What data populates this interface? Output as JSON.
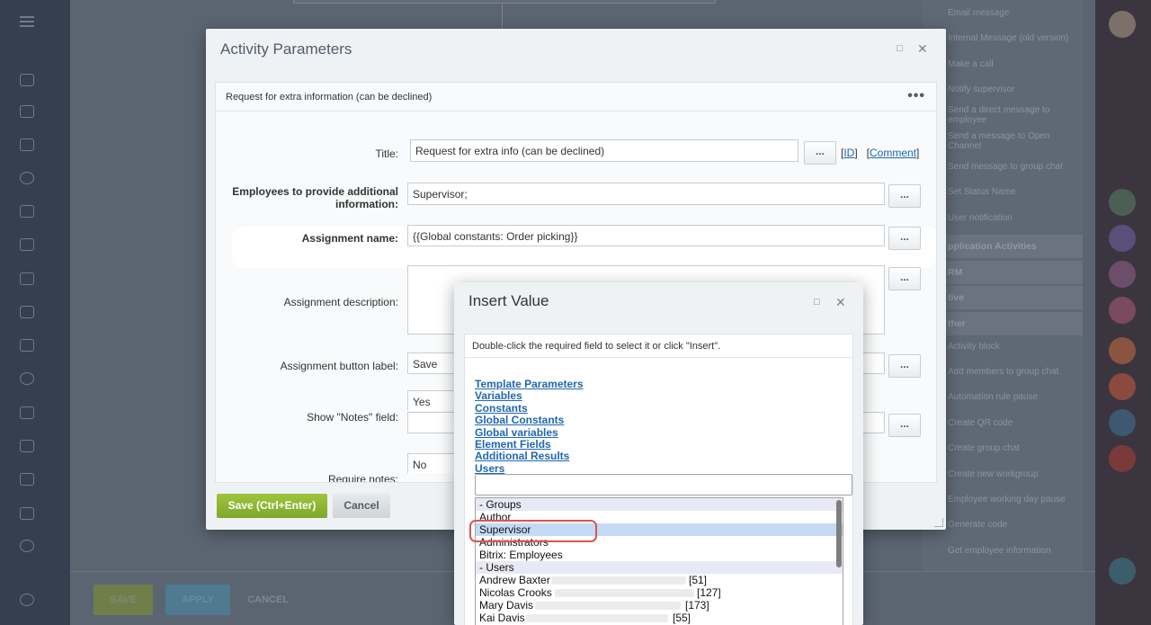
{
  "activity_dialog": {
    "title": "Activity Parameters",
    "subtitle": "Request for extra information (can be declined)",
    "fields": {
      "title_label": "Title:",
      "title_value": "Request for extra info (can be declined)",
      "employees_label_1": "Employees to provide additional",
      "employees_label_2": "information:",
      "employees_value": "Supervisor;",
      "assignment_name_label": "Assignment name:",
      "assignment_name_value": "{{Global constants: Order picking}}",
      "assignment_desc_label": "Assignment description:",
      "button_label_label": "Assignment button label:",
      "button_label_value": "Save",
      "notes_label": "Show \"Notes\" field:",
      "notes_value": "Yes",
      "require_notes_label": "Require notes:",
      "require_notes_value": "No"
    },
    "ellipsis": "...",
    "id_link": "ID",
    "comment_link": "Comment",
    "save_button": "Save (Ctrl+Enter)",
    "cancel_button": "Cancel"
  },
  "insert_value_dialog": {
    "title": "Insert Value",
    "hint": "Double-click the required field to select it or click \"Insert\".",
    "sections": [
      "Template Parameters",
      "Variables",
      "Constants",
      "Global Constants",
      "Global variables",
      "Element Fields",
      "Additional Results",
      "Users"
    ],
    "list": [
      {
        "label": "- Groups",
        "kind": "group"
      },
      {
        "label": "Author",
        "kind": "item"
      },
      {
        "label": "Supervisor",
        "kind": "selected"
      },
      {
        "label": "Administrators",
        "kind": "item"
      },
      {
        "label": "Bitrix: Employees",
        "kind": "item"
      },
      {
        "label": "- Users",
        "kind": "group"
      },
      {
        "label": "Andrew Baxter",
        "kind": "user",
        "id": "[51]"
      },
      {
        "label": "Nicolas Crooks",
        "kind": "user",
        "id": "[127]"
      },
      {
        "label": "Mary Davis",
        "kind": "user",
        "id": "[173]"
      },
      {
        "label": "Kai Davis",
        "kind": "user",
        "id": "[55]"
      }
    ]
  },
  "catalog": {
    "items": [
      "Email message",
      "Internal Message (old version)",
      "Make a call",
      "Notify supervisor",
      "Send a direct message to employee",
      "Send a message to Open Channel",
      "Send message to group chat",
      "Set Status Name",
      "User notification"
    ],
    "headers": [
      "pplication Activities",
      "RM",
      "tive",
      "ther"
    ],
    "other_items": [
      "Activity block",
      "Add members to group chat",
      "Automation rule pause",
      "Create QR code",
      "Create group chat",
      "Create new workgroup",
      "Employee working day pause",
      "Generate code",
      "Get employee information"
    ]
  },
  "bottom_bar": {
    "save": "SAVE",
    "apply": "APPLY",
    "cancel": "CANCEL"
  },
  "colors": {
    "accent_green": "#8bb634",
    "link_blue": "#2067b0",
    "highlight_red": "#e0534a",
    "selection": "#c5daf4"
  }
}
